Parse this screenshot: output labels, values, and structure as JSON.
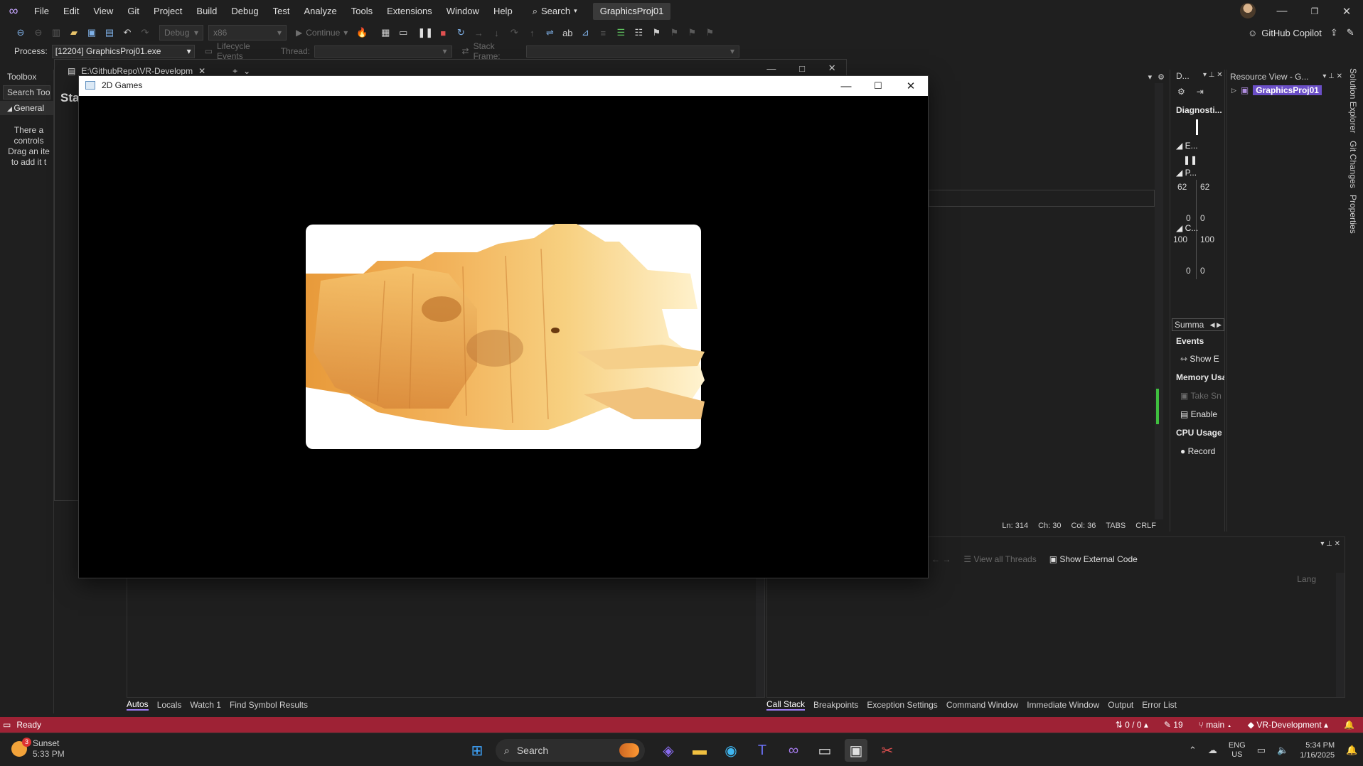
{
  "menubar": {
    "items": [
      "File",
      "Edit",
      "View",
      "Git",
      "Project",
      "Build",
      "Debug",
      "Test",
      "Analyze",
      "Tools",
      "Extensions",
      "Window",
      "Help"
    ],
    "search_label": "Search",
    "project_name": "GraphicsProj01"
  },
  "toolbar": {
    "config": "Debug",
    "platform": "x86",
    "continue_label": "Continue",
    "copilot_label": "GitHub Copilot"
  },
  "procbar": {
    "process_label": "Process:",
    "process_value": "[12204] GraphicsProj01.exe",
    "lifecycle_label": "Lifecycle Events",
    "thread_label": "Thread:",
    "stackframe_label": "Stack Frame:"
  },
  "toolbox": {
    "title": "Toolbox",
    "search_placeholder": "Search Tooll",
    "group": "General",
    "hint": "There a\ncontrols\nDrag an ite\nto add it t"
  },
  "document": {
    "tab_label": "E:\\GithubRepo\\VR-Developm",
    "start_text": "Sta"
  },
  "editor_status": {
    "ln": "Ln: 314",
    "ch": "Ch: 30",
    "col": "Col: 36",
    "tabs": "TABS",
    "eol": "CRLF"
  },
  "diagnostics": {
    "title": "D...",
    "heading": "Diagnosti...",
    "events_short": "E...",
    "process_short": "P...",
    "cpu_short": "C...",
    "mem_top_left": "62",
    "mem_top_right": "62",
    "mem_bottom_left": "0",
    "mem_bottom_right": "0",
    "cpu_top_left": "100",
    "cpu_top_right": "100",
    "cpu_bottom_left": "0",
    "cpu_bottom_right": "0",
    "summary_tab": "Summa",
    "events_header": "Events",
    "show_events": "Show E",
    "memory_header": "Memory Usa",
    "take_snapshot": "Take Sn",
    "enable": "Enable",
    "cpu_header": "CPU Usage",
    "record": "Record"
  },
  "resource_view": {
    "title": "Resource View - G...",
    "node": "GraphicsProj01"
  },
  "side_tabs": [
    "Solution Explorer",
    "Git Changes",
    "Properties"
  ],
  "bottom_left_tabs": [
    "Autos",
    "Locals",
    "Watch 1",
    "Find Symbol Results"
  ],
  "bottom_right_tabs": [
    "Call Stack",
    "Breakpoints",
    "Exception Settings",
    "Command Window",
    "Immediate Window",
    "Output",
    "Error List"
  ],
  "callstack": {
    "view_threads": "View all Threads",
    "show_external": "Show External Code",
    "lang_col": "Lang"
  },
  "statusbar": {
    "ready": "Ready",
    "changes": "0 / 0",
    "edits": "19",
    "branch": "main",
    "repo": "VR-Development"
  },
  "taskbar": {
    "weather_title": "Sunset",
    "weather_time": "5:33 PM",
    "weather_badge": "3",
    "search_label": "Search",
    "lang_top": "ENG",
    "lang_bottom": "US",
    "clock_time": "5:34 PM",
    "clock_date": "1/16/2025"
  },
  "game_window": {
    "title": "2D Games"
  },
  "colors": {
    "accent": "#9d7cf0",
    "statusbar": "#9e2235",
    "background": "#1f1f1f"
  }
}
